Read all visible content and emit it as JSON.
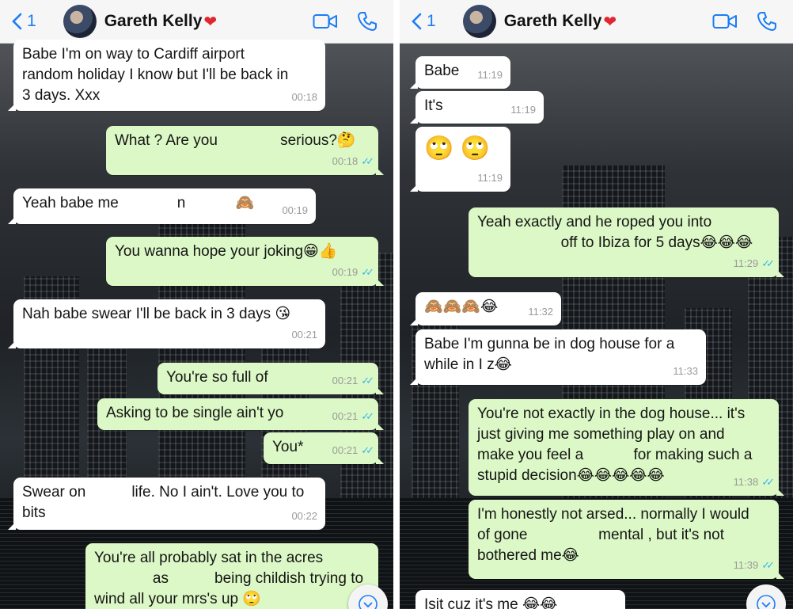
{
  "left": {
    "header": {
      "back_count": "1",
      "contact_name": "Gareth Kelly",
      "heart": "❤"
    },
    "messages": [
      {
        "dir": "in",
        "text": "Babe I'm on way to Cardiff airport\nrandom holiday I know but I'll be back in\n3 days. Xxx",
        "time": "00:18"
      },
      {
        "dir": "out",
        "text": "What ? Are you               serious?🤔",
        "time": "00:18"
      },
      {
        "dir": "in",
        "text": "Yeah babe me              n            🙈",
        "time": "00:19"
      },
      {
        "dir": "out",
        "text": "You wanna hope your joking😁👍",
        "time": "00:19"
      },
      {
        "dir": "in",
        "text": "Nah babe swear I'll be back in 3 days 😘",
        "time": "00:21"
      },
      {
        "dir": "out",
        "text": "You're so full of",
        "time": "00:21"
      },
      {
        "dir": "out",
        "text": "Asking to be single ain't yo",
        "time": "00:21"
      },
      {
        "dir": "out",
        "text": "You*",
        "time": "00:21"
      },
      {
        "dir": "in",
        "text": "Swear on           life. No I ain't. Love you to\nbits",
        "time": "00:22"
      },
      {
        "dir": "out",
        "text": "You're all probably sat in the acres\n              as           being childish trying to\nwind all your mrs's up 🙄",
        "time": ""
      }
    ]
  },
  "right": {
    "header": {
      "back_count": "1",
      "contact_name": "Gareth Kelly",
      "heart": "❤"
    },
    "messages": [
      {
        "dir": "in",
        "text": "Babe",
        "time": "11:19"
      },
      {
        "dir": "in",
        "text": "It's",
        "time": "11:19"
      },
      {
        "dir": "in",
        "text": "🙄 🙄",
        "time": "11:19",
        "emoji": true
      },
      {
        "dir": "out",
        "text": "Yeah exactly and he roped you into\n                    off to Ibiza for 5 days😂😂😂",
        "time": "11:29"
      },
      {
        "dir": "in",
        "text": "🙈🙈🙈😂",
        "time": "11:32"
      },
      {
        "dir": "in",
        "text": "Babe I'm gunna be in dog house for a\nwhile in I z😂",
        "time": "11:33"
      },
      {
        "dir": "out",
        "text": "You're not exactly in the dog house... it's\njust giving me something play on and\nmake you feel a            for making such a\nstupid decision😂😂😂😂😂",
        "time": "11:38"
      },
      {
        "dir": "out",
        "text": "I'm honestly not arsed... normally I would\nof gone                 mental , but it's not\nbothered me😂",
        "time": "11:39"
      },
      {
        "dir": "in",
        "text": "Isit cuz it's me 😂😂",
        "time": ""
      }
    ]
  },
  "colors": {
    "accent": "#1a7cf5",
    "outgoing": "#dcf8c6",
    "incoming": "#ffffff",
    "ticks": "#34b7f1",
    "heart": "#e0262f"
  },
  "icons": {
    "back": "chevron-left-icon",
    "video": "video-call-icon",
    "call": "phone-icon",
    "scroll": "scroll-down-icon"
  }
}
